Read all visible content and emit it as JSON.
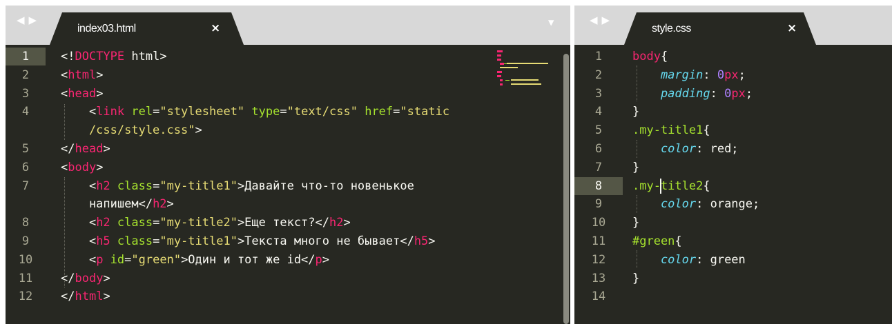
{
  "left_pane": {
    "tab_title": "index03.html",
    "close_glyph": "×",
    "lines": [
      {
        "num": "1",
        "code": [
          [
            "<!",
            "w"
          ],
          [
            "DOCTYPE",
            "t"
          ],
          [
            " html>",
            "w"
          ]
        ]
      },
      {
        "num": "2",
        "code": [
          [
            "<",
            "w"
          ],
          [
            "html",
            "t"
          ],
          [
            ">",
            "w"
          ]
        ]
      },
      {
        "num": "3",
        "code": [
          [
            "<",
            "w"
          ],
          [
            "head",
            "t"
          ],
          [
            ">",
            "w"
          ]
        ]
      },
      {
        "num": "4",
        "code": [
          [
            "    <",
            "w"
          ],
          [
            "link",
            "t"
          ],
          [
            " rel",
            "a"
          ],
          [
            "=",
            "w"
          ],
          [
            "\"stylesheet\"",
            "s"
          ],
          [
            " type",
            "a"
          ],
          [
            "=",
            "w"
          ],
          [
            "\"text/css\"",
            "s"
          ],
          [
            " href",
            "a"
          ],
          [
            "=",
            "w"
          ],
          [
            "\"static",
            "s"
          ]
        ]
      },
      {
        "num": "",
        "code": [
          [
            "    /css/style.css\"",
            "s"
          ],
          [
            ">",
            "w"
          ]
        ]
      },
      {
        "num": "5",
        "code": [
          [
            "</",
            "w"
          ],
          [
            "head",
            "t"
          ],
          [
            ">",
            "w"
          ]
        ]
      },
      {
        "num": "6",
        "code": [
          [
            "<",
            "w"
          ],
          [
            "body",
            "t"
          ],
          [
            ">",
            "w"
          ]
        ]
      },
      {
        "num": "7",
        "code": [
          [
            "    <",
            "w"
          ],
          [
            "h2",
            "t"
          ],
          [
            " class",
            "a"
          ],
          [
            "=",
            "w"
          ],
          [
            "\"my-title1\"",
            "s"
          ],
          [
            ">Давайте что-то новенькое",
            "w"
          ]
        ]
      },
      {
        "num": "",
        "code": [
          [
            "    напишем</",
            "w"
          ],
          [
            "h2",
            "t"
          ],
          [
            ">",
            "w"
          ]
        ]
      },
      {
        "num": "8",
        "code": [
          [
            "    <",
            "w"
          ],
          [
            "h2",
            "t"
          ],
          [
            " class",
            "a"
          ],
          [
            "=",
            "w"
          ],
          [
            "\"my-title2\"",
            "s"
          ],
          [
            ">Еще текст?</",
            "w"
          ],
          [
            "h2",
            "t"
          ],
          [
            ">",
            "w"
          ]
        ]
      },
      {
        "num": "9",
        "code": [
          [
            "    <",
            "w"
          ],
          [
            "h5",
            "t"
          ],
          [
            " class",
            "a"
          ],
          [
            "=",
            "w"
          ],
          [
            "\"my-title1\"",
            "s"
          ],
          [
            ">Текста много не бывает</",
            "w"
          ],
          [
            "h5",
            "t"
          ],
          [
            ">",
            "w"
          ]
        ]
      },
      {
        "num": "10",
        "code": [
          [
            "    <",
            "w"
          ],
          [
            "p",
            "t"
          ],
          [
            " id",
            "a"
          ],
          [
            "=",
            "w"
          ],
          [
            "\"green\"",
            "s"
          ],
          [
            ">Один и тот же id</",
            "w"
          ],
          [
            "p",
            "t"
          ],
          [
            ">",
            "w"
          ]
        ]
      },
      {
        "num": "11",
        "code": [
          [
            "</",
            "w"
          ],
          [
            "body",
            "t"
          ],
          [
            ">",
            "w"
          ]
        ]
      },
      {
        "num": "12",
        "code": [
          [
            "</",
            "w"
          ],
          [
            "html",
            "t"
          ],
          [
            ">",
            "w"
          ]
        ]
      }
    ]
  },
  "right_pane": {
    "tab_title": "style.css",
    "close_glyph": "×",
    "lines": [
      {
        "num": "1",
        "code": [
          [
            "body",
            "t"
          ],
          [
            "{",
            "w"
          ]
        ]
      },
      {
        "num": "2",
        "code": [
          [
            "    margin",
            "k"
          ],
          [
            ": ",
            "w"
          ],
          [
            "0",
            "n"
          ],
          [
            "px",
            "t"
          ],
          [
            ";",
            "w"
          ]
        ]
      },
      {
        "num": "3",
        "code": [
          [
            "    padding",
            "k"
          ],
          [
            ": ",
            "w"
          ],
          [
            "0",
            "n"
          ],
          [
            "px",
            "t"
          ],
          [
            ";",
            "w"
          ]
        ]
      },
      {
        "num": "4",
        "code": [
          [
            "}",
            "w"
          ]
        ]
      },
      {
        "num": "5",
        "code": [
          [
            ".my-title1",
            "a"
          ],
          [
            "{",
            "w"
          ]
        ]
      },
      {
        "num": "6",
        "code": [
          [
            "    color",
            "k"
          ],
          [
            ": red;",
            "w"
          ]
        ]
      },
      {
        "num": "7",
        "code": [
          [
            "}",
            "w"
          ]
        ]
      },
      {
        "num": "8",
        "code": [
          [
            ".my-title2",
            "a"
          ],
          [
            "{",
            "w"
          ]
        ]
      },
      {
        "num": "9",
        "code": [
          [
            "    color",
            "k"
          ],
          [
            ": orange;",
            "w"
          ]
        ]
      },
      {
        "num": "10",
        "code": [
          [
            "}",
            "w"
          ]
        ]
      },
      {
        "num": "11",
        "code": [
          [
            "#green",
            "a"
          ],
          [
            "{",
            "w"
          ]
        ]
      },
      {
        "num": "12",
        "code": [
          [
            "    color",
            "k"
          ],
          [
            ": green",
            "w"
          ]
        ]
      },
      {
        "num": "13",
        "code": [
          [
            "}",
            "w"
          ]
        ]
      },
      {
        "num": "14",
        "code": []
      }
    ]
  },
  "icons": {
    "nav_back": "◀",
    "nav_forward": "▶",
    "dropdown": "▼"
  },
  "colors": {
    "background": "#272822",
    "tag": "#f92672",
    "attribute": "#a6e22e",
    "string": "#e6db74",
    "property": "#66d9ef",
    "number": "#ae81ff",
    "text": "#f8f8f2"
  }
}
